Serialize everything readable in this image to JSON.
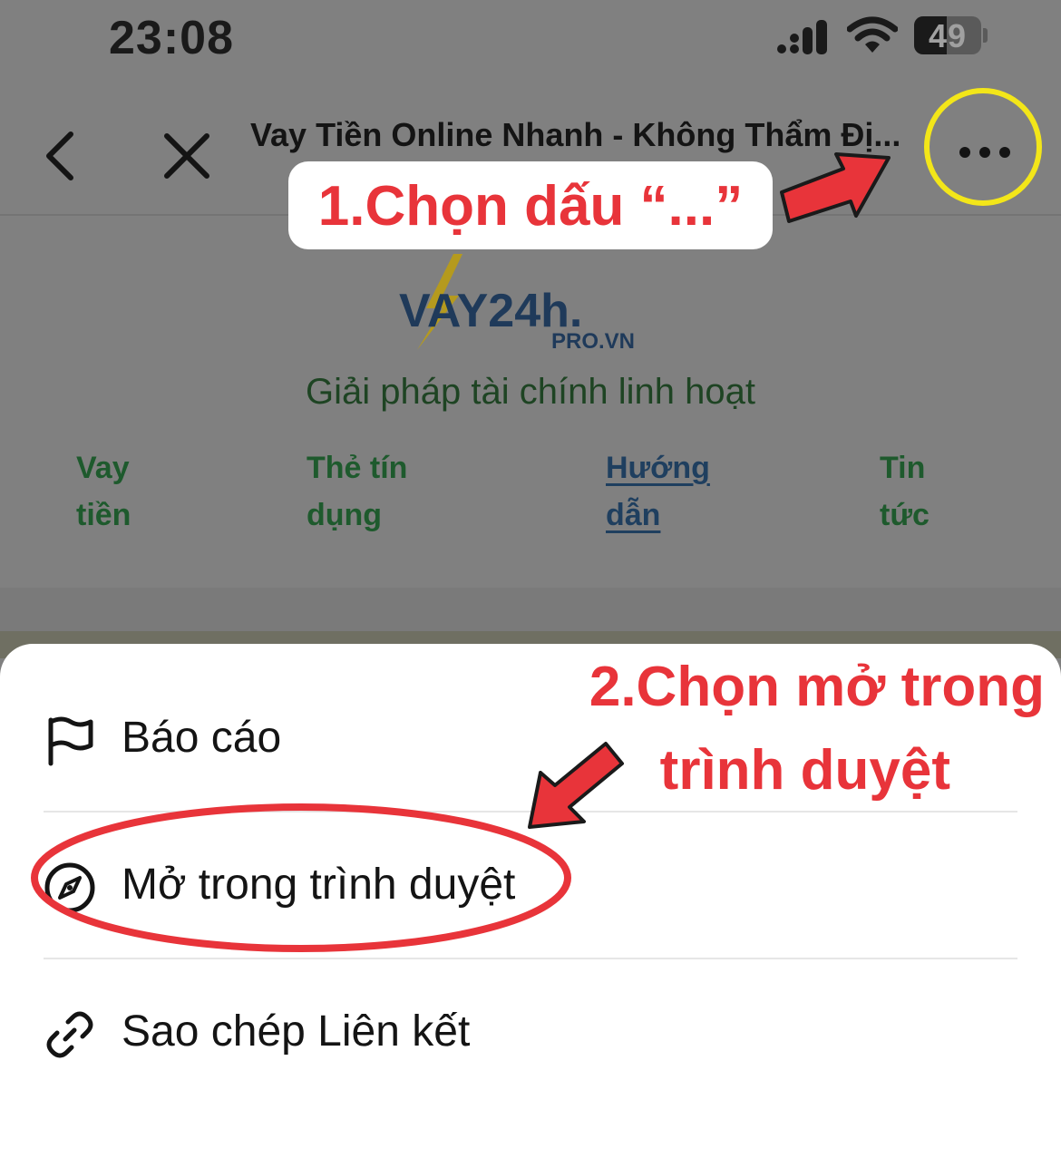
{
  "status_bar": {
    "time": "23:08",
    "battery": "49",
    "signal_icon": "cellular-signal-icon",
    "wifi_icon": "wifi-icon"
  },
  "nav": {
    "title": "Vay Tiền Online Nhanh - Không Thẩm Đị...",
    "back_icon": "chevron-left-icon",
    "close_icon": "close-icon",
    "more_icon": "ellipsis-icon"
  },
  "site": {
    "logo_main": "VAY24h.",
    "logo_sub": "PRO.VN",
    "tagline": "Giải pháp tài chính linh hoạt",
    "nav_items": [
      {
        "line1": "Vay",
        "line2": "tiền"
      },
      {
        "line1": "Thẻ tín",
        "line2": "dụng"
      },
      {
        "line1": "Hướng",
        "line2": "dẫn"
      },
      {
        "line1": "Tin",
        "line2": "tức"
      }
    ]
  },
  "sheet": {
    "items": [
      {
        "label": "Báo cáo",
        "icon": "flag-icon"
      },
      {
        "label": "Mở trong trình duyệt",
        "icon": "compass-icon"
      },
      {
        "label": "Sao chép Liên kết",
        "icon": "link-icon"
      }
    ]
  },
  "annotations": {
    "step1": "1.Chọn dấu “...”",
    "step2_line1": "2.Chọn mở trong",
    "step2_line2": "trình duyệt"
  },
  "colors": {
    "annotation_red": "#e8343a",
    "highlight_yellow": "#f3e619",
    "dim_overlay": "#808080",
    "tagline_green": "#1e4423"
  }
}
